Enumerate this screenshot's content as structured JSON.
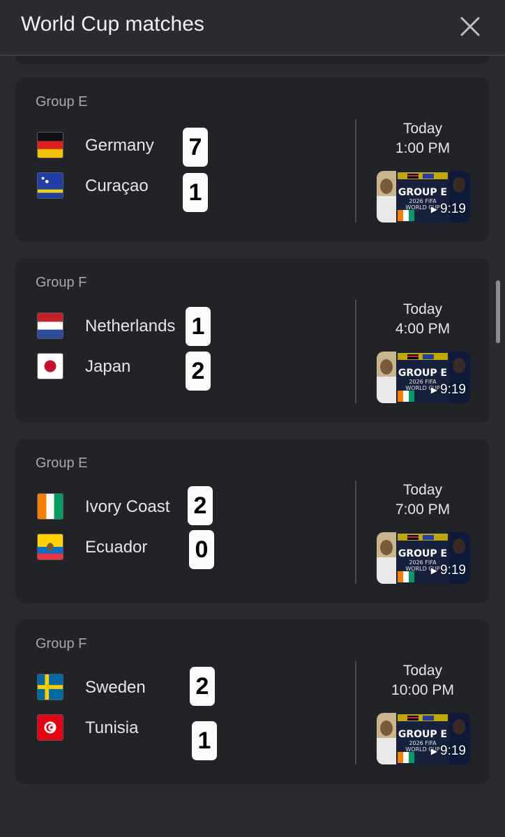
{
  "header": {
    "title": "World Cup matches"
  },
  "thumbnail": {
    "text_line1": "GROUP E",
    "text_line2": "2026 FIFA",
    "text_line3": "WORLD CUP"
  },
  "matches": [
    {
      "group": "Group E",
      "home": {
        "name": "Germany",
        "flag": "germany-flag",
        "score": "7"
      },
      "away": {
        "name": "Curaçao",
        "flag": "curacao-flag",
        "score": "1"
      },
      "day": "Today",
      "time": "1:00 PM",
      "duration": "9:19"
    },
    {
      "group": "Group F",
      "home": {
        "name": "Netherlands",
        "flag": "netherlands-flag",
        "score": "1"
      },
      "away": {
        "name": "Japan",
        "flag": "japan-flag",
        "score": "2"
      },
      "day": "Today",
      "time": "4:00 PM",
      "duration": "9:19"
    },
    {
      "group": "Group E",
      "home": {
        "name": "Ivory Coast",
        "flag": "ivory-coast-flag",
        "score": "2"
      },
      "away": {
        "name": "Ecuador",
        "flag": "ecuador-flag",
        "score": "0"
      },
      "day": "Today",
      "time": "7:00 PM",
      "duration": "9:19"
    },
    {
      "group": "Group F",
      "home": {
        "name": "Sweden",
        "flag": "sweden-flag",
        "score": "2"
      },
      "away": {
        "name": "Tunisia",
        "flag": "tunisia-flag",
        "score": "1"
      },
      "day": "Today",
      "time": "10:00 PM",
      "duration": "9:19"
    }
  ]
}
